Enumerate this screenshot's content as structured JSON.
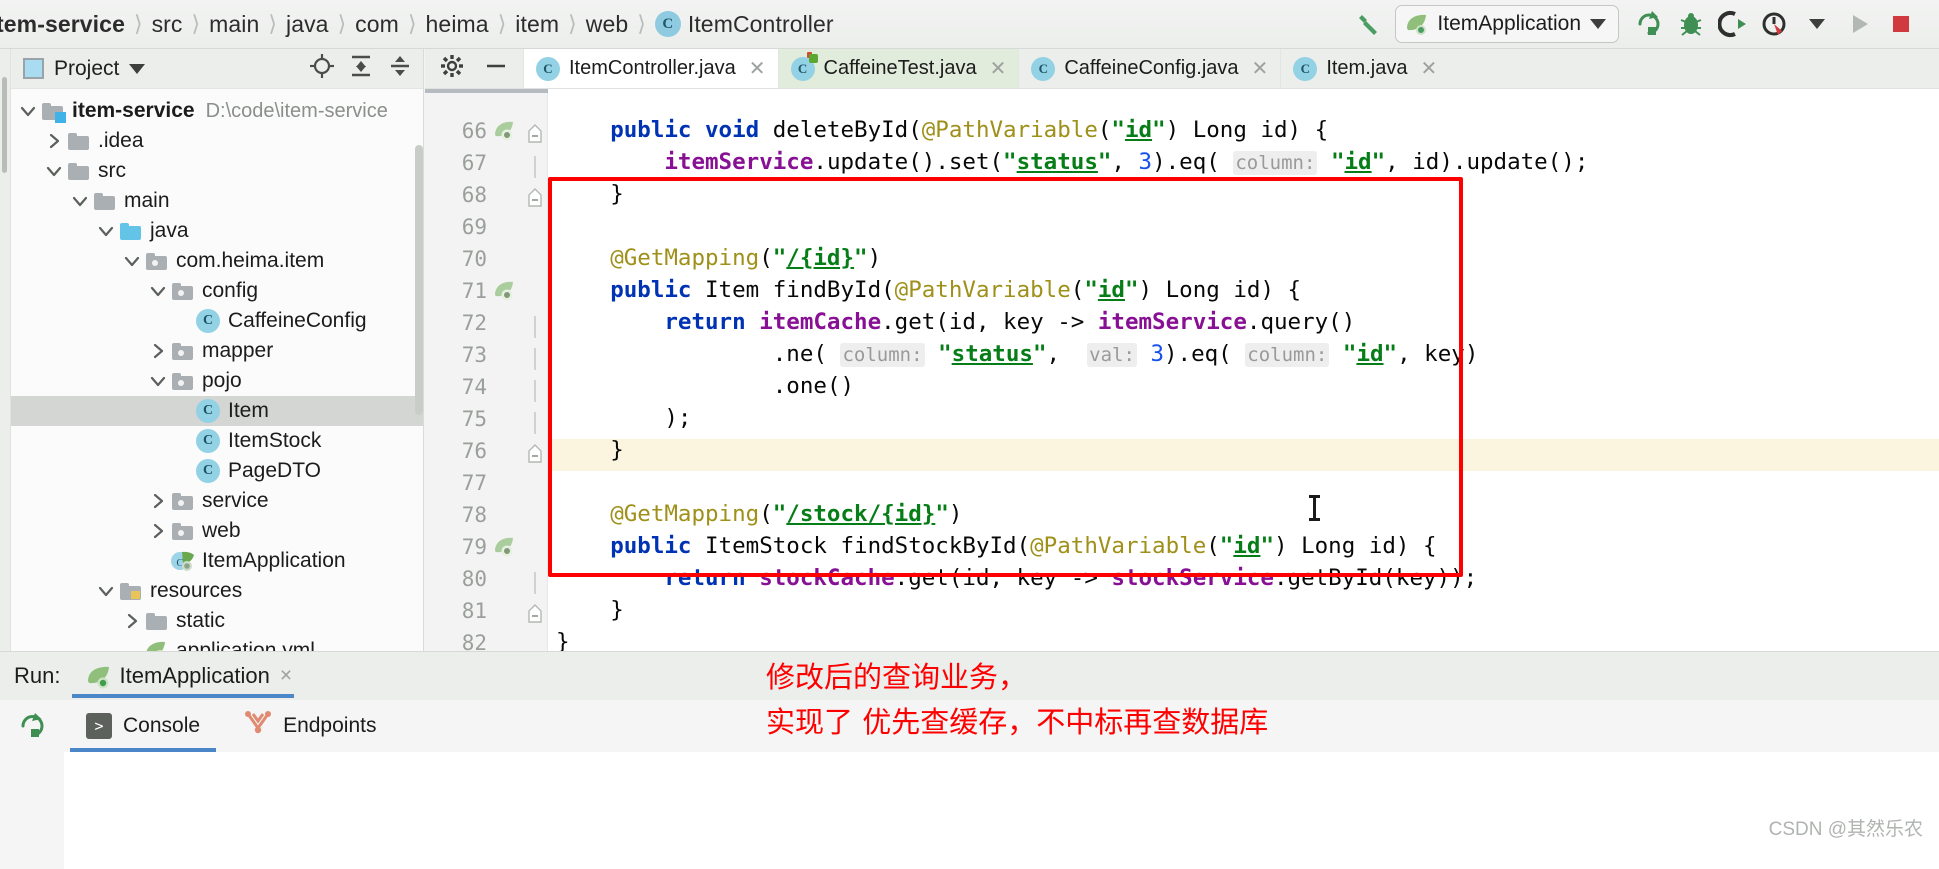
{
  "breadcrumb": {
    "items": [
      {
        "label": "tem-service",
        "icon": "none",
        "bold": true
      },
      {
        "label": "src",
        "icon": "none",
        "bold": false
      },
      {
        "label": "main",
        "icon": "none",
        "bold": false
      },
      {
        "label": "java",
        "icon": "none",
        "bold": false
      },
      {
        "label": "com",
        "icon": "none",
        "bold": false
      },
      {
        "label": "heima",
        "icon": "none",
        "bold": false
      },
      {
        "label": "item",
        "icon": "none",
        "bold": false
      },
      {
        "label": "web",
        "icon": "none",
        "bold": false
      }
    ],
    "current_class": "ItemController",
    "class_badge": "C",
    "separator": "〉"
  },
  "toolbar": {
    "build_icon": "hammer-icon",
    "run_config": "ItemApplication",
    "run_config_caret": "▼",
    "run_icon": "run-icon",
    "rerun_icon": "rerun-icon",
    "debug_icon": "debug-bug-icon",
    "run_with_coverage_icon": "run-coverage-icon",
    "profiler_icon": "profiler-icon",
    "profiler_caret": "▼",
    "stop_icon": "stop-icon"
  },
  "project_panel": {
    "title": "Project",
    "title_caret": "▼",
    "icons": [
      "locate-icon",
      "expand-all-icon",
      "collapse-all-icon",
      "settings-gear-icon",
      "hide-icon"
    ],
    "tree": [
      {
        "label": "item-service",
        "path": "D:\\code\\item-service",
        "depth": 0,
        "arrow": "down",
        "icon": "module-folder",
        "bold": true,
        "selected": false
      },
      {
        "label": ".idea",
        "path": "",
        "depth": 1,
        "arrow": "right",
        "icon": "folder",
        "bold": false,
        "selected": false
      },
      {
        "label": "src",
        "path": "",
        "depth": 1,
        "arrow": "down",
        "icon": "folder",
        "bold": false,
        "selected": false
      },
      {
        "label": "main",
        "path": "",
        "depth": 2,
        "arrow": "down",
        "icon": "folder",
        "bold": false,
        "selected": false
      },
      {
        "label": "java",
        "path": "",
        "depth": 3,
        "arrow": "down",
        "icon": "source-folder",
        "bold": false,
        "selected": false
      },
      {
        "label": "com.heima.item",
        "path": "",
        "depth": 4,
        "arrow": "down",
        "icon": "package",
        "bold": false,
        "selected": false
      },
      {
        "label": "config",
        "path": "",
        "depth": 5,
        "arrow": "down",
        "icon": "package",
        "bold": false,
        "selected": false
      },
      {
        "label": "CaffeineConfig",
        "path": "",
        "depth": 6,
        "arrow": "none",
        "icon": "class",
        "bold": false,
        "selected": false
      },
      {
        "label": "mapper",
        "path": "",
        "depth": 5,
        "arrow": "right",
        "icon": "package",
        "bold": false,
        "selected": false
      },
      {
        "label": "pojo",
        "path": "",
        "depth": 5,
        "arrow": "down",
        "icon": "package",
        "bold": false,
        "selected": false
      },
      {
        "label": "Item",
        "path": "",
        "depth": 6,
        "arrow": "none",
        "icon": "class",
        "bold": false,
        "selected": true
      },
      {
        "label": "ItemStock",
        "path": "",
        "depth": 6,
        "arrow": "none",
        "icon": "class",
        "bold": false,
        "selected": false
      },
      {
        "label": "PageDTO",
        "path": "",
        "depth": 6,
        "arrow": "none",
        "icon": "class",
        "bold": false,
        "selected": false
      },
      {
        "label": "service",
        "path": "",
        "depth": 5,
        "arrow": "right",
        "icon": "package",
        "bold": false,
        "selected": false
      },
      {
        "label": "web",
        "path": "",
        "depth": 5,
        "arrow": "right",
        "icon": "package",
        "bold": false,
        "selected": false
      },
      {
        "label": "ItemApplication",
        "path": "",
        "depth": 5,
        "arrow": "none",
        "icon": "spring-class",
        "bold": false,
        "selected": false
      },
      {
        "label": "resources",
        "path": "",
        "depth": 3,
        "arrow": "down",
        "icon": "resource-folder",
        "bold": false,
        "selected": false
      },
      {
        "label": "static",
        "path": "",
        "depth": 4,
        "arrow": "right",
        "icon": "folder",
        "bold": false,
        "selected": false
      },
      {
        "label": "application.yml",
        "path": "",
        "depth": 4,
        "arrow": "none",
        "icon": "spring-yaml",
        "bold": false,
        "selected": false
      }
    ]
  },
  "editor": {
    "tabs": [
      {
        "label": "ItemController.java",
        "badge": "C",
        "state": "active",
        "closable": true
      },
      {
        "label": "CaffeineTest.java",
        "badge": "C",
        "state": "test",
        "closable": true
      },
      {
        "label": "CaffeineConfig.java",
        "badge": "C",
        "state": "normal",
        "closable": true
      },
      {
        "label": "Item.java",
        "badge": "C",
        "state": "normal",
        "closable": true
      }
    ],
    "gear_icon": "settings-gear-icon",
    "minimize_icon": "minimize-icon",
    "line_numbers": [
      "66",
      "67",
      "68",
      "69",
      "70",
      "71",
      "72",
      "73",
      "74",
      "75",
      "76",
      "77",
      "78",
      "79",
      "80",
      "81",
      "82"
    ],
    "highlighted_line": "77",
    "code_lines": [
      {
        "num": "66",
        "text": "    public void deleteById(@PathVariable(\"id\") Long id) {"
      },
      {
        "num": "67",
        "text": "        itemService.update().set(\"status\", 3).eq( column: \"id\", id).update();"
      },
      {
        "num": "68",
        "text": "    }"
      },
      {
        "num": "69",
        "text": ""
      },
      {
        "num": "70",
        "text": "    @GetMapping(\"/{id}\")"
      },
      {
        "num": "71",
        "text": "    public Item findById(@PathVariable(\"id\") Long id) {"
      },
      {
        "num": "72",
        "text": "        return itemCache.get(id, key -> itemService.query()"
      },
      {
        "num": "73",
        "text": "                .ne( column: \"status\",  val: 3).eq( column: \"id\", key)"
      },
      {
        "num": "74",
        "text": "                .one()"
      },
      {
        "num": "75",
        "text": "        );"
      },
      {
        "num": "76",
        "text": "    }"
      },
      {
        "num": "77",
        "text": ""
      },
      {
        "num": "78",
        "text": "    @GetMapping(\"/stock/{id}\")"
      },
      {
        "num": "79",
        "text": "    public ItemStock findStockById(@PathVariable(\"id\") Long id) {"
      },
      {
        "num": "80",
        "text": "        return stockCache.get(id, key -> stockService.getById(key));"
      },
      {
        "num": "81",
        "text": "    }"
      },
      {
        "num": "82",
        "text": "}"
      }
    ]
  },
  "run_panel": {
    "run_label": "Run:",
    "run_tab": "ItemApplication",
    "run_tab_close": "×",
    "rerun_icon": "rerun-icon",
    "console_tabs": [
      {
        "label": "Console",
        "icon": "console-icon",
        "active": true
      },
      {
        "label": "Endpoints",
        "icon": "endpoints-icon",
        "active": false
      }
    ]
  },
  "annotation": {
    "line1": "修改后的查询业务，",
    "line2": "实现了 优先查缓存，不中标再查数据库",
    "color": "#ff0000"
  },
  "watermark": "CSDN @其然乐农",
  "colors": {
    "accent_red": "#ff0000",
    "tab_underline": "#4a86c8",
    "keyword": "#0033b3",
    "string": "#067d17",
    "annotation": "#9e9019",
    "field": "#871094",
    "number": "#1750eb",
    "highlight_row": "#fbf5e0"
  }
}
